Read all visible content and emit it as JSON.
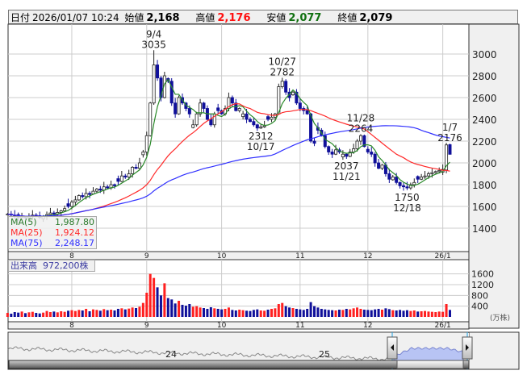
{
  "header": {
    "date_label": "日付",
    "date_value": "2026/01/07 10:24",
    "open_label": "始値",
    "open_value": "2,168",
    "high_label": "高値",
    "high_value": "2,176",
    "low_label": "安値",
    "low_value": "2,077",
    "close_label": "終値",
    "close_value": "2,079"
  },
  "legend": {
    "ma5_label": "MA(5)",
    "ma5_value": "1,987.80",
    "ma25_label": "MA(25)",
    "ma25_value": "1,924.12",
    "ma75_label": "MA(75)",
    "ma75_value": "2,248.17"
  },
  "volume_label": {
    "label": "出来高",
    "value": "972,200株"
  },
  "colors": {
    "up": "#ff2020",
    "down": "#10109a",
    "ma5": "#2a8a2a",
    "ma25": "#ff2a2a",
    "ma75": "#3030ff",
    "nav_fill": "#b8c4f4"
  },
  "chart_data": {
    "type": "candlestick",
    "price_axis": {
      "min": 1400,
      "max": 3000,
      "step": 200,
      "ticks": [
        "1400",
        "1600",
        "1800",
        "2000",
        "2200",
        "2400",
        "2600",
        "2800",
        "3000"
      ]
    },
    "volume_axis": {
      "ticks": [
        "400",
        "800",
        "1200",
        "1600"
      ],
      "unit": "(万株)"
    },
    "month_labels": [
      {
        "index": 18,
        "label": "8"
      },
      {
        "index": 39,
        "label": "9"
      },
      {
        "index": 60,
        "label": "10"
      },
      {
        "index": 82,
        "label": "11"
      },
      {
        "index": 101,
        "label": "12"
      },
      {
        "index": 122,
        "label": "26/1"
      }
    ],
    "closes": [
      1530,
      1520,
      1510,
      1500,
      1505,
      1495,
      1510,
      1520,
      1515,
      1500,
      1510,
      1525,
      1540,
      1530,
      1545,
      1560,
      1580,
      1600,
      1640,
      1660,
      1700,
      1690,
      1720,
      1710,
      1740,
      1760,
      1750,
      1780,
      1770,
      1800,
      1790,
      1830,
      1880,
      1870,
      1900,
      1960,
      1950,
      2000,
      2100,
      2250,
      2550,
      2900,
      2780,
      2600,
      2800,
      2750,
      2550,
      2450,
      2600,
      2550,
      2500,
      2450,
      2350,
      2450,
      2550,
      2500,
      2400,
      2350,
      2450,
      2480,
      2450,
      2500,
      2600,
      2550,
      2480,
      2500,
      2450,
      2400,
      2380,
      2350,
      2320,
      2330,
      2340,
      2400,
      2420,
      2450,
      2700,
      2750,
      2650,
      2600,
      2650,
      2550,
      2500,
      2480,
      2450,
      2200,
      2180,
      2300,
      2250,
      2150,
      2100,
      2080,
      2120,
      2100,
      2080,
      2060,
      2100,
      2130,
      2200,
      2250,
      2150,
      2100,
      2080,
      2000,
      1950,
      1980,
      1900,
      1850,
      1870,
      1820,
      1790,
      1780,
      1770,
      1800,
      1820,
      1850,
      1870,
      1880,
      1900,
      1910,
      1920,
      1930,
      1940,
      2165,
      2079
    ],
    "overrides": [
      {
        "index": 124,
        "open": 2168,
        "high": 2176,
        "low": 2077
      },
      {
        "index": 123,
        "open": 1935
      }
    ],
    "volume": [
      150,
      120,
      180,
      160,
      200,
      140,
      170,
      190,
      150,
      130,
      160,
      220,
      180,
      200,
      170,
      210,
      190,
      230,
      250,
      220,
      260,
      240,
      300,
      210,
      280,
      260,
      230,
      290,
      250,
      270,
      240,
      300,
      320,
      280,
      310,
      350,
      330,
      380,
      520,
      900,
      1600,
      1450,
      1100,
      800,
      1250,
      700,
      650,
      500,
      600,
      450,
      420,
      480,
      380,
      400,
      350,
      330,
      300,
      360,
      320,
      300,
      280,
      300,
      350,
      260,
      240,
      270,
      250,
      230,
      220,
      260,
      280,
      240,
      230,
      270,
      300,
      320,
      480,
      520,
      400,
      350,
      330,
      300,
      280,
      260,
      300,
      550,
      400,
      350,
      300,
      280,
      260,
      250,
      240,
      270,
      260,
      300,
      280,
      320,
      350,
      300,
      270,
      260,
      250,
      280,
      300,
      270,
      320,
      290,
      250,
      240,
      260,
      230,
      250,
      220,
      240,
      200,
      210,
      220,
      200,
      190,
      180,
      200,
      190,
      480,
      260
    ],
    "annotations": [
      {
        "index": 41,
        "kind": "high",
        "date": "9/4",
        "price": 3035
      },
      {
        "index": 77,
        "kind": "high",
        "date": "10/27",
        "price": 2782
      },
      {
        "index": 71,
        "kind": "low",
        "date": "10/17",
        "price": 2312
      },
      {
        "index": 95,
        "kind": "low",
        "date": "11/21",
        "price": 2037
      },
      {
        "index": 99,
        "kind": "high",
        "date": "11/28",
        "price": 2264
      },
      {
        "index": 112,
        "kind": "low",
        "date": "12/18",
        "price": 1750
      },
      {
        "index": 124,
        "kind": "high",
        "date": "1/7",
        "price": 2176
      }
    ]
  },
  "navigator": {
    "labels": [
      "24",
      "25"
    ]
  }
}
